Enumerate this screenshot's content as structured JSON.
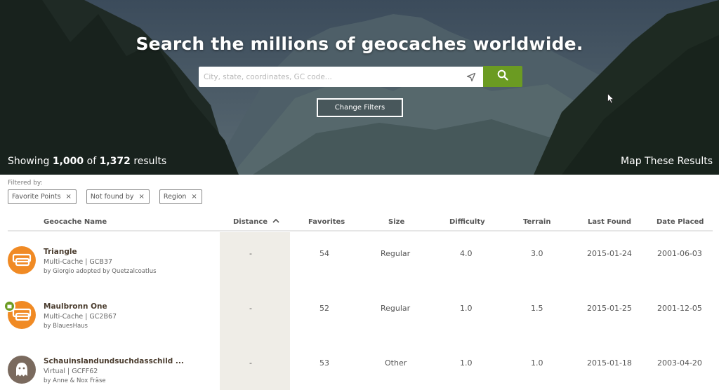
{
  "hero": {
    "title": "Search the millions of geocaches worldwide.",
    "search_placeholder": "City, state, coordinates, GC code...",
    "change_filters_label": "Change Filters",
    "showing_prefix": "Showing ",
    "showing_count": "1,000",
    "showing_of": " of ",
    "showing_total": "1,372",
    "showing_suffix": " results",
    "map_results_label": "Map These Results"
  },
  "filters": {
    "label": "Filtered by:",
    "chips": [
      {
        "label": "Favorite Points",
        "remove": "×"
      },
      {
        "label": "Not found by",
        "remove": "×"
      },
      {
        "label": "Region",
        "remove": "×"
      }
    ]
  },
  "table": {
    "columns": {
      "name": "Geocache Name",
      "distance": "Distance",
      "favorites": "Favorites",
      "size": "Size",
      "difficulty": "Difficulty",
      "terrain": "Terrain",
      "last_found": "Last Found",
      "date_placed": "Date Placed"
    },
    "rows": [
      {
        "icon": "multi-cache-icon",
        "name": "Triangle",
        "type": "Multi-Cache | GCB37",
        "owner": "by Giorgio adopted by Quetzalcoatlus",
        "distance": "-",
        "favorites": "54",
        "size": "Regular",
        "difficulty": "4.0",
        "terrain": "3.0",
        "last_found": "2015-01-24",
        "date_placed": "2001-06-03"
      },
      {
        "icon": "multi-cache-icon",
        "name": "Maulbronn One",
        "type": "Multi-Cache | GC2B67",
        "owner": "by BlauesHaus",
        "distance": "-",
        "favorites": "52",
        "size": "Regular",
        "difficulty": "1.0",
        "terrain": "1.5",
        "last_found": "2015-01-25",
        "date_placed": "2001-12-05"
      },
      {
        "icon": "virtual-cache-icon",
        "name": "Schauinslandundsuchdasschild ...",
        "type": "Virtual | GCFF62",
        "owner": "by Anne & Nox Fräse",
        "distance": "-",
        "favorites": "53",
        "size": "Other",
        "difficulty": "1.0",
        "terrain": "1.0",
        "last_found": "2015-01-18",
        "date_placed": "2003-04-20"
      }
    ]
  },
  "colors": {
    "accent_green": "#6b9b22",
    "multi_cache_orange": "#f08a24",
    "virtual_brown": "#7a6a5e",
    "distance_column_bg": "#efede7"
  }
}
